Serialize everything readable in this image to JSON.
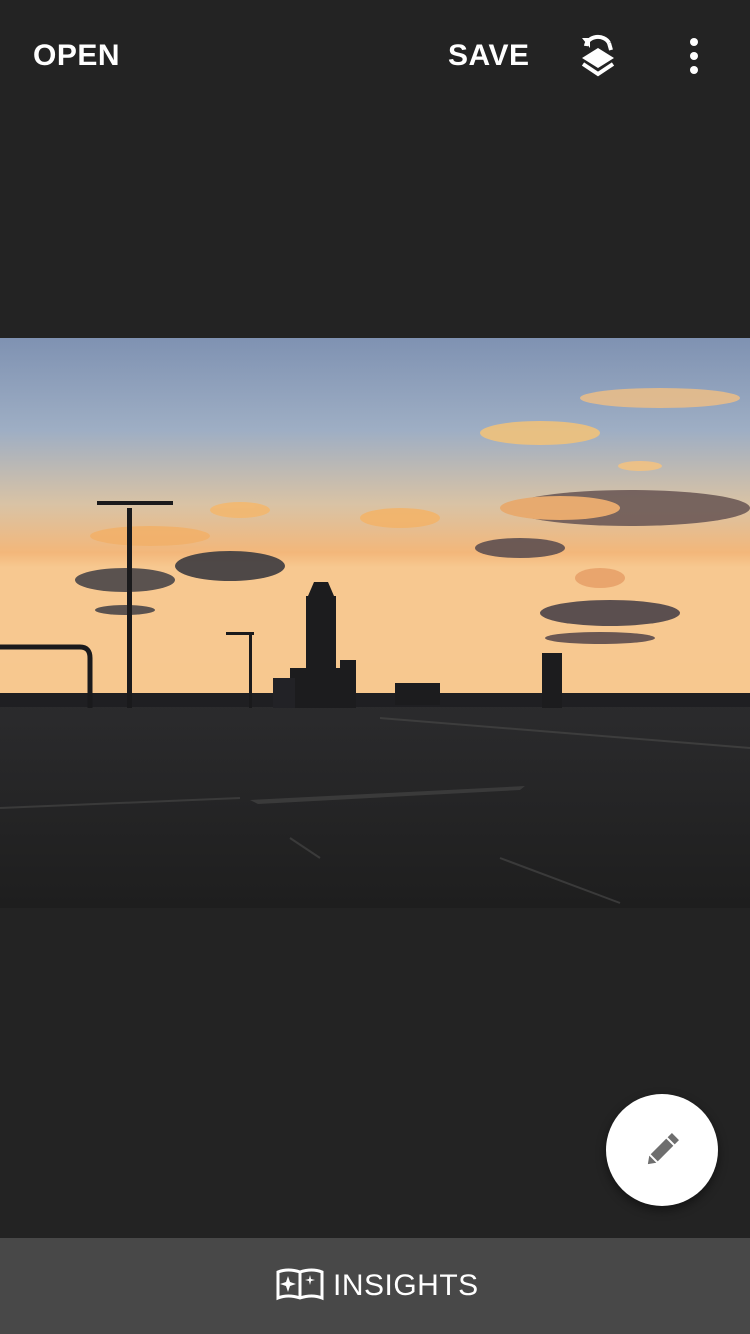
{
  "toolbar": {
    "open_label": "OPEN",
    "save_label": "SAVE",
    "layers_icon": "layers-undo-icon",
    "more_icon": "more-vert-icon"
  },
  "photo": {
    "description_icon": "sunset-airport-photo"
  },
  "fab": {
    "icon": "pencil-icon"
  },
  "bottom_bar": {
    "insights_label": "INSIGHTS",
    "insights_icon": "book-sparkle-icon"
  },
  "colors": {
    "background": "#232323",
    "bottom_bar": "#484848",
    "fab": "#ffffff",
    "fab_icon": "#6e6e6e",
    "text": "#ffffff"
  }
}
